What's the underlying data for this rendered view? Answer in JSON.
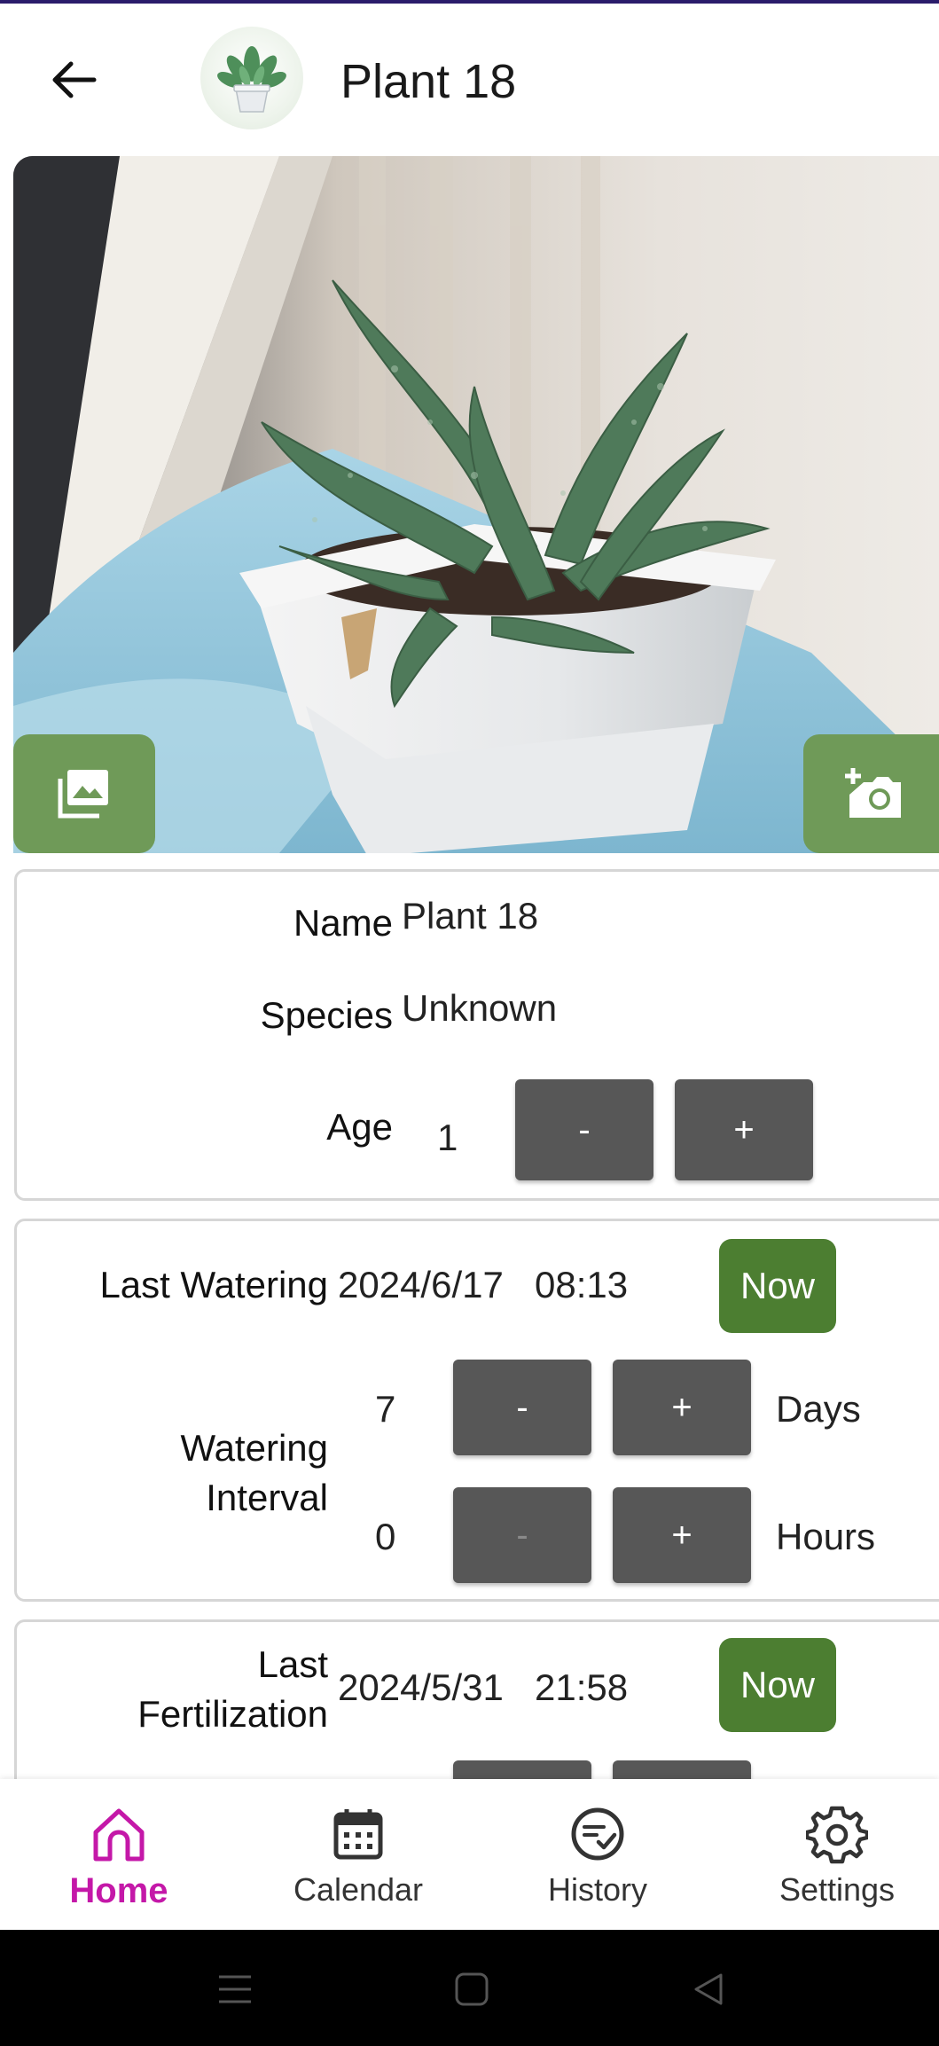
{
  "header": {
    "title": "Plant 18",
    "back_icon": "arrow-left-icon",
    "avatar_icon": "potted-plant-icon"
  },
  "photo": {
    "gallery_icon": "image-gallery-icon",
    "camera_icon": "add-photo-camera-icon"
  },
  "info": {
    "name_label": "Name",
    "name_value": "Plant 18",
    "species_label": "Species",
    "species_value": "Unknown",
    "age_label": "Age",
    "age_value": "1",
    "minus": "-",
    "plus": "+"
  },
  "watering": {
    "last_label": "Last Watering",
    "last_date": "2024/6/17",
    "last_time": "08:13",
    "now_label": "Now",
    "interval_label_1": "Watering",
    "interval_label_2": "Interval",
    "days_value": "7",
    "days_unit": "Days",
    "hours_value": "0",
    "hours_unit": "Hours",
    "minus": "-",
    "plus": "+"
  },
  "fertilization": {
    "last_label_1": "Last",
    "last_label_2": "Fertilization",
    "last_date": "2024/5/31",
    "last_time": "21:58",
    "now_label": "Now"
  },
  "nav": {
    "items": [
      {
        "label": "Home",
        "icon": "home-icon",
        "active": true
      },
      {
        "label": "Calendar",
        "icon": "calendar-icon",
        "active": false
      },
      {
        "label": "History",
        "icon": "history-check-icon",
        "active": false
      },
      {
        "label": "Settings",
        "icon": "gear-icon",
        "active": false
      }
    ]
  },
  "system": {
    "menu_icon": "menu-icon",
    "home_icon": "square-home-icon",
    "back_icon": "triangle-back-icon"
  },
  "colors": {
    "accent_green": "#4c7e31",
    "photo_button_green": "#6f9a58",
    "button_gray": "#575757",
    "nav_active": "#c418a8"
  }
}
